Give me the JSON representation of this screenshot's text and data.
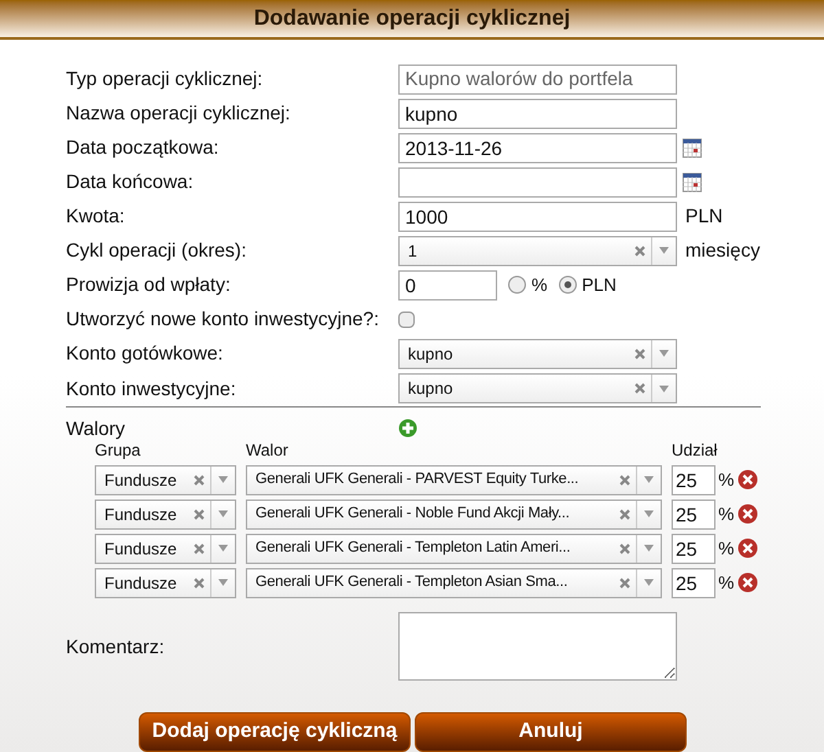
{
  "title": "Dodawanie operacji cyklicznej",
  "fields": [
    {
      "kind": "readonly",
      "label": "Typ operacji cyklicznej:",
      "value": "Kupno walorów do portfela"
    },
    {
      "kind": "text",
      "label": "Nazwa operacji cyklicznej:",
      "value": "kupno"
    },
    {
      "kind": "date",
      "label": "Data początkowa:",
      "value": "2013-11-26"
    },
    {
      "kind": "date",
      "label": "Data końcowa:"
    },
    {
      "kind": "text",
      "label": "Kwota:",
      "value": "1000",
      "unit": "PLN"
    },
    {
      "kind": "select",
      "label": "Cykl operacji (okres):",
      "value": "1",
      "unit": "miesięcy"
    },
    {
      "kind": "radio",
      "label": "Prowizja od wpłaty:",
      "value": "0",
      "options": [
        {
          "label": "%",
          "selected": false
        },
        {
          "label": "PLN",
          "selected": true
        }
      ]
    },
    {
      "kind": "checkbox",
      "label": "Utworzyć nowe konto inwestycyjne?:",
      "checked": false
    },
    {
      "kind": "select",
      "label": "Konto gotówkowe:",
      "value": "kupno"
    },
    {
      "kind": "select",
      "label": "Konto inwestycyjne:",
      "value": "kupno"
    }
  ],
  "walory": {
    "label": "Walory",
    "columns": [
      "Grupa",
      "Walor",
      "Udział"
    ],
    "rows": [
      {
        "group": "Fundusze",
        "walor": "Generali UFK Generali - PARVEST Equity Turke...",
        "share": "25",
        "unit": "%"
      },
      {
        "group": "Fundusze",
        "walor": "Generali UFK Generali - Noble Fund Akcji Mały...",
        "share": "25",
        "unit": "%"
      },
      {
        "group": "Fundusze",
        "walor": "Generali UFK Generali - Templeton Latin Ameri...",
        "share": "25",
        "unit": "%"
      },
      {
        "group": "Fundusze",
        "walor": "Generali UFK Generali - Templeton Asian Sma...",
        "share": "25",
        "unit": "%"
      }
    ]
  },
  "comment": {
    "label": "Komentarz:"
  },
  "buttons": [
    "Dodaj operację cykliczną",
    "Anuluj"
  ]
}
